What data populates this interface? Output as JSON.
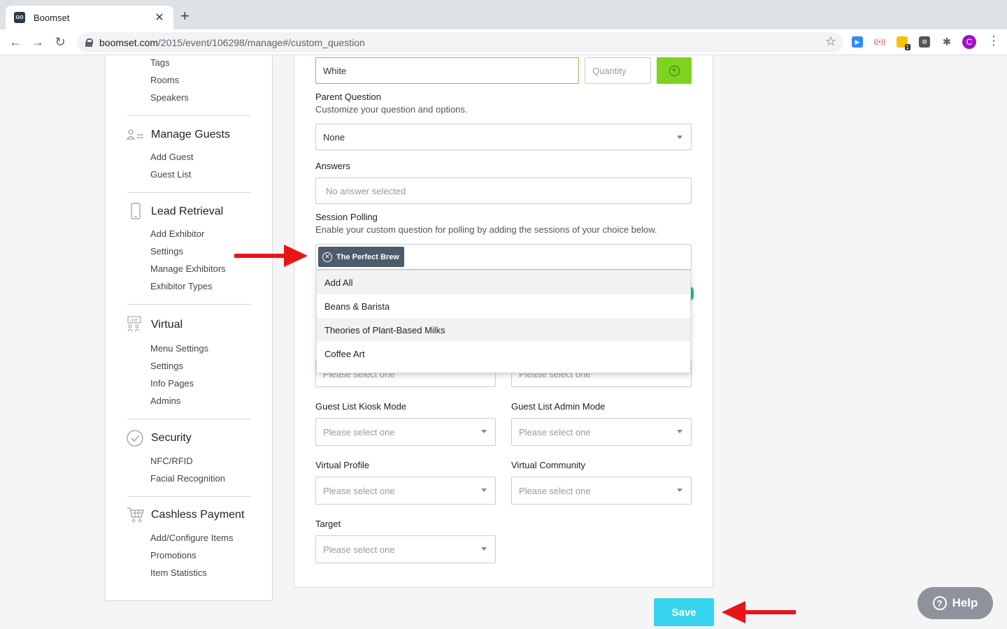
{
  "browser": {
    "tab_title": "Boomset",
    "favicon_text": "GO",
    "url_host": "boomset.com",
    "url_path": "/2015/event/106298/manage#/custom_question",
    "profile_initial": "C",
    "ext_badge": "1"
  },
  "sidebar": {
    "top_items": [
      "Tags",
      "Rooms",
      "Speakers"
    ],
    "sections": [
      {
        "title": "Manage Guests",
        "icon": "guests-icon",
        "items": [
          "Add Guest",
          "Guest List"
        ]
      },
      {
        "title": "Lead Retrieval",
        "icon": "phone-icon",
        "items": [
          "Add Exhibitor",
          "Settings",
          "Manage Exhibitors",
          "Exhibitor Types"
        ]
      },
      {
        "title": "Virtual",
        "icon": "live-icon",
        "items": [
          "Menu Settings",
          "Settings",
          "Info Pages",
          "Admins"
        ]
      },
      {
        "title": "Security",
        "icon": "check-circle-icon",
        "items": [
          "NFC/RFID",
          "Facial Recognition"
        ]
      },
      {
        "title": "Cashless Payment",
        "icon": "cart-icon",
        "items": [
          "Add/Configure Items",
          "Promotions",
          "Item Statistics"
        ]
      }
    ]
  },
  "form": {
    "option_value": "White",
    "quantity_placeholder": "Quantity",
    "parent_question": {
      "label": "Parent Question",
      "hint": "Customize your question and options.",
      "value": "None"
    },
    "answers": {
      "label": "Answers",
      "placeholder": "No answer selected"
    },
    "session_polling": {
      "label": "Session Polling",
      "hint": "Enable your custom question for polling by adding the sessions of your choice below.",
      "selected_chip": "The Perfect Brew",
      "options": [
        "Add All",
        "Beans & Barista",
        "Theories of Plant-Based Milks",
        "Coffee Art"
      ]
    },
    "peek_placeholder": "Please select one",
    "selects": [
      {
        "label": "Guest List Kiosk Mode",
        "value": "Please select one"
      },
      {
        "label": "Guest List Admin Mode",
        "value": "Please select one"
      },
      {
        "label": "Virtual Profile",
        "value": "Please select one"
      },
      {
        "label": "Virtual Community",
        "value": "Please select one"
      },
      {
        "label": "Target",
        "value": "Please select one"
      }
    ]
  },
  "actions": {
    "save_label": "Save",
    "help_label": "Help"
  },
  "colors": {
    "accent_save": "#36d4ef",
    "add_button": "#7ed321",
    "annotation_arrow": "#e8141a",
    "chip": "#4e5b6b"
  }
}
